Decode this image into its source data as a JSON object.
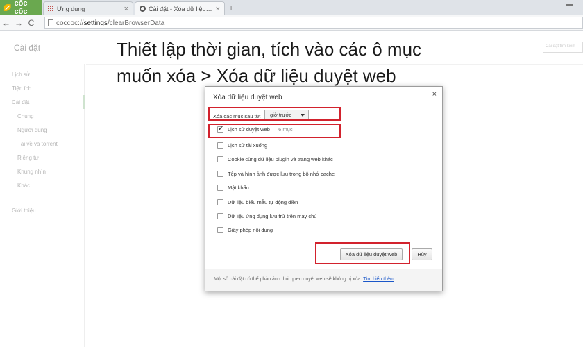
{
  "browser": {
    "brand": "cốc cốc",
    "tabs": [
      {
        "title": "Ứng dụng",
        "close": "×"
      },
      {
        "title": "Cài đặt - Xóa dữ liệu duyệt w",
        "close": "×"
      }
    ],
    "new_tab": "+",
    "nav": {
      "back": "←",
      "forward": "→",
      "reload": "C"
    },
    "url": {
      "prefix": "coccoc://",
      "bold": "settings",
      "suffix": "/clearBrowserData"
    }
  },
  "settings": {
    "title": "Cài đặt",
    "search_placeholder": "Cài đặt tìm kiếm",
    "sidebar": [
      "Lịch sử",
      "Tiện ích",
      "Cài đặt",
      "Chung",
      "Người dùng",
      "Tải về và torrent",
      "Riêng tư",
      "Khung nhìn",
      "Khác",
      "Giới thiệu"
    ]
  },
  "caption": {
    "line1": "Thiết lập thời gian, tích vào các ô mục",
    "line2": "muốn xóa > Xóa dữ liệu duyệt web"
  },
  "dialog": {
    "title": "Xóa dữ liệu duyệt web",
    "close": "×",
    "period_label": "Xóa các mục sau từ:",
    "period_value": "giờ trước",
    "items": [
      {
        "label": "Lịch sử duyệt web",
        "detail": "– 6 mục",
        "checked": true
      },
      {
        "label": "Lịch sử tải xuống",
        "detail": "",
        "checked": false
      },
      {
        "label": "Cookie cùng dữ liệu plugin và trang web khác",
        "detail": "",
        "checked": false
      },
      {
        "label": "Tệp và hình ảnh được lưu trong bộ nhớ cache",
        "detail": "",
        "checked": false
      },
      {
        "label": "Mật khẩu",
        "detail": "",
        "checked": false
      },
      {
        "label": "Dữ liệu biểu mẫu tự động điền",
        "detail": "",
        "checked": false
      },
      {
        "label": "Dữ liệu ứng dụng lưu trữ trên máy chủ",
        "detail": "",
        "checked": false
      },
      {
        "label": "Giấy phép nội dung",
        "detail": "",
        "checked": false
      }
    ],
    "primary_button": "Xóa dữ liệu duyệt web",
    "cancel_button": "Hủy",
    "footer_text": "Một số cài đặt có thể phản ánh thói quen duyệt web sẽ không bị xóa.",
    "footer_link": "Tìm hiểu thêm"
  },
  "colors": {
    "highlight": "#d2222d",
    "brand": "#6aa84f",
    "link": "#1a57c9"
  }
}
